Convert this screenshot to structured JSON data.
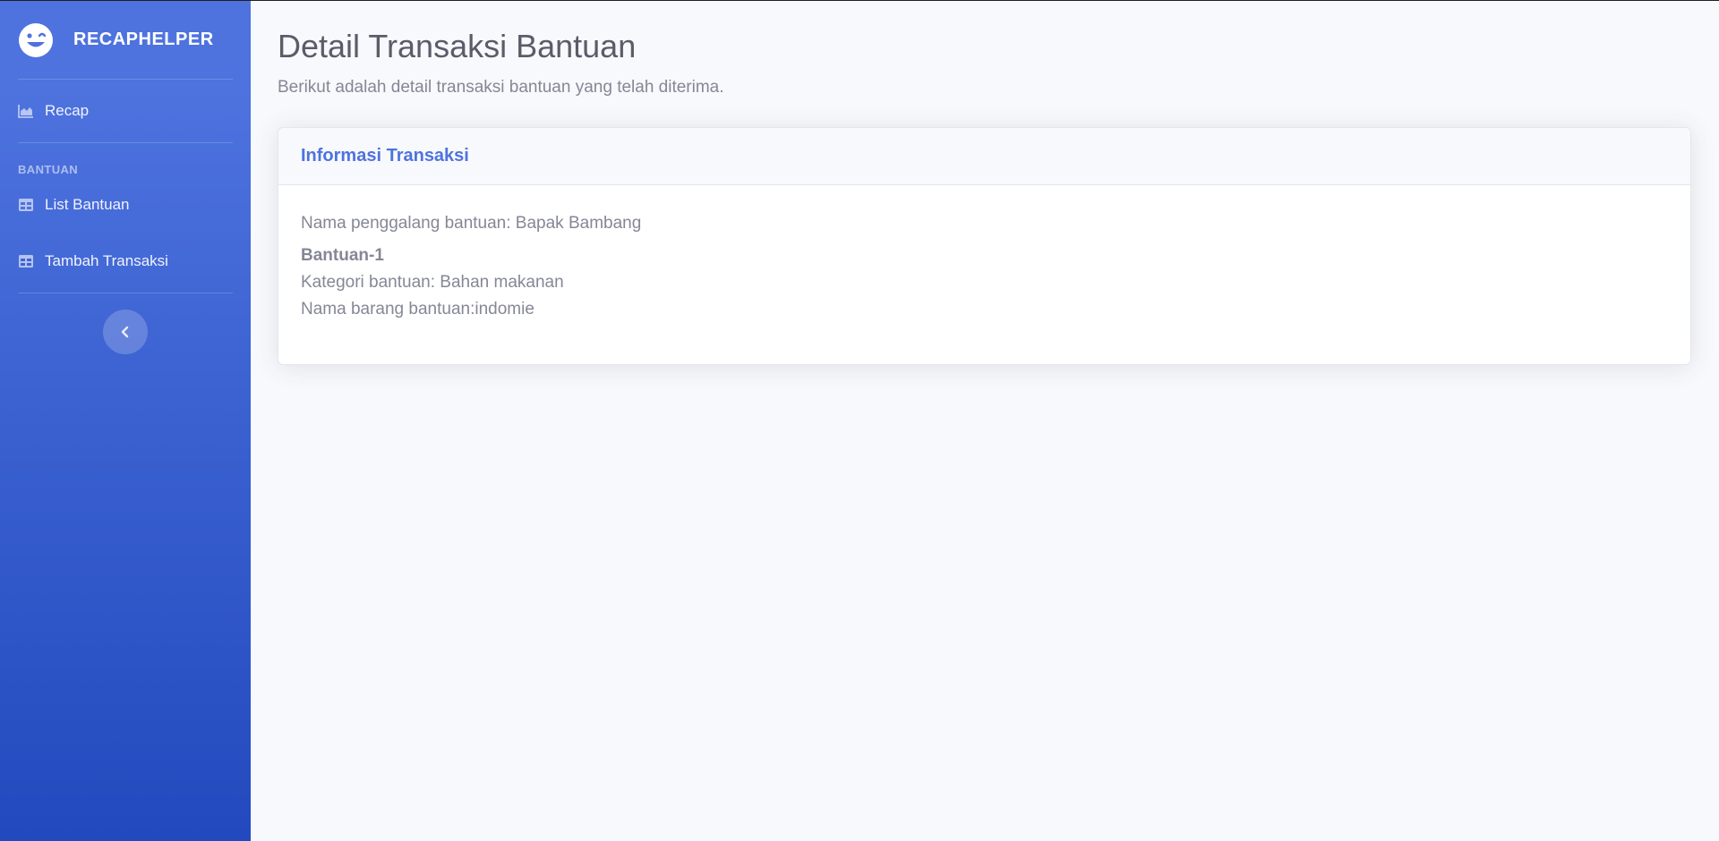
{
  "sidebar": {
    "brand": "RECAPHELPER",
    "items": [
      {
        "label": "Recap",
        "icon": "area-chart-icon"
      },
      {
        "label": "List Bantuan",
        "icon": "table-icon"
      },
      {
        "label": "Tambah Transaksi",
        "icon": "table-icon"
      }
    ],
    "heading": "BANTUAN"
  },
  "main": {
    "title": "Detail Transaksi Bantuan",
    "subtitle": "Berikut adalah detail transaksi bantuan yang telah diterima."
  },
  "card": {
    "header": "Informasi Transaksi",
    "penggalang": "Nama penggalang bantuan: Bapak Bambang",
    "bantuan_title": "Bantuan-1",
    "kategori": "Kategori bantuan: Bahan makanan",
    "barang": "Nama barang bantuan:indomie"
  },
  "colors": {
    "primary": "#4e73df",
    "sidebar_bottom": "#224abe",
    "text_muted": "#858796",
    "title": "#5a5c69"
  }
}
